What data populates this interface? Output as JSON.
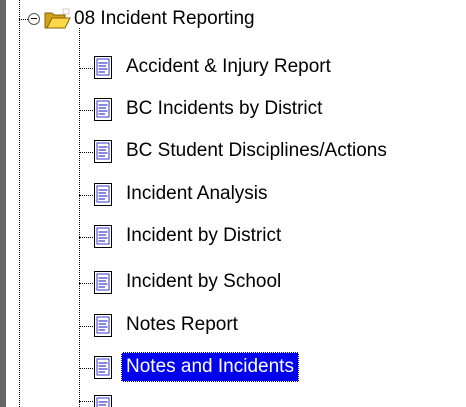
{
  "tree": {
    "folder": {
      "label": "08 Incident Reporting",
      "icon": "folder-icon",
      "expanded": true
    },
    "items": [
      {
        "label": "Accident & Injury Report",
        "icon": "document-icon",
        "selected": false
      },
      {
        "label": "BC Incidents by District",
        "icon": "document-icon",
        "selected": false
      },
      {
        "label": "BC Student Disciplines/Actions",
        "icon": "document-icon",
        "selected": false
      },
      {
        "label": "Incident Analysis",
        "icon": "document-icon",
        "selected": false
      },
      {
        "label": "Incident by District",
        "icon": "document-icon",
        "selected": false
      },
      {
        "label": "Incident by School",
        "icon": "document-icon",
        "selected": false
      },
      {
        "label": "Notes Report",
        "icon": "document-icon",
        "selected": false
      },
      {
        "label": "Notes and Incidents",
        "icon": "document-icon",
        "selected": true
      }
    ]
  },
  "colors": {
    "selection_background": "#0000ee",
    "selection_text": "#ffffff",
    "left_bar": "#666666"
  }
}
